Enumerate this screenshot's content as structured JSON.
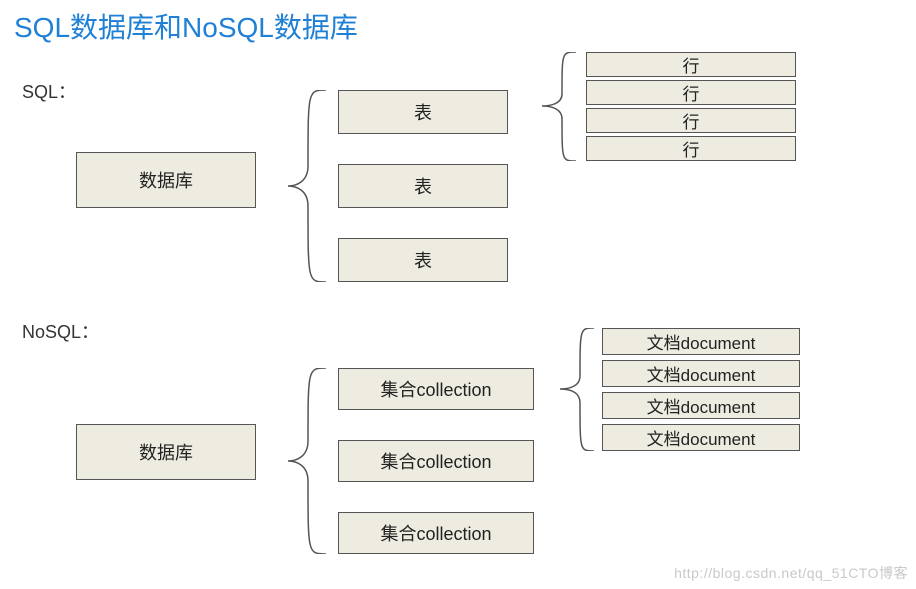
{
  "title": "SQL数据库和NoSQL数据库",
  "sql": {
    "label": "SQL：",
    "db": "数据库",
    "tables": [
      "表",
      "表",
      "表"
    ],
    "rows": [
      "行",
      "行",
      "行",
      "行"
    ]
  },
  "nosql": {
    "label": "NoSQL：",
    "db": "数据库",
    "collections": [
      "集合collection",
      "集合collection",
      "集合collection"
    ],
    "documents": [
      "文档document",
      "文档document",
      "文档document",
      "文档document"
    ]
  },
  "watermark": "http://blog.csdn.net/qq_51CTO博客"
}
